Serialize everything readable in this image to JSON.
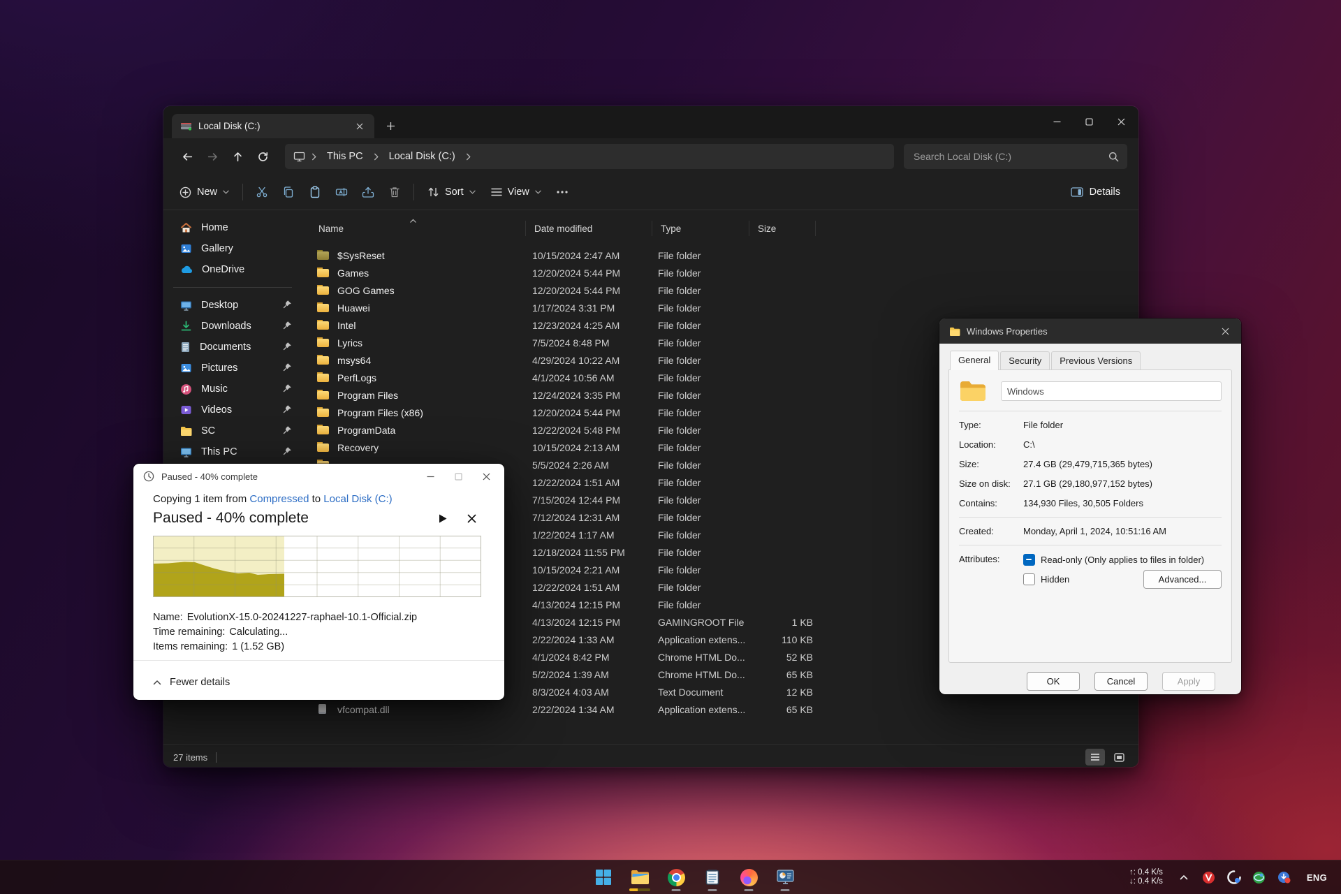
{
  "explorer": {
    "tab_title": "Local Disk (C:)",
    "breadcrumb": {
      "items": [
        "This PC",
        "Local Disk (C:)"
      ]
    },
    "search": {
      "placeholder": "Search Local Disk (C:)"
    },
    "commandbar": {
      "new_label": "New",
      "sort_label": "Sort",
      "view_label": "View",
      "details_label": "Details"
    },
    "columns": {
      "name": "Name",
      "date": "Date modified",
      "type": "Type",
      "size": "Size"
    },
    "sidebar": {
      "items": [
        {
          "label": "Home"
        },
        {
          "label": "Gallery"
        },
        {
          "label": "OneDrive"
        },
        {
          "label": "Desktop"
        },
        {
          "label": "Downloads"
        },
        {
          "label": "Documents"
        },
        {
          "label": "Pictures"
        },
        {
          "label": "Music"
        },
        {
          "label": "Videos"
        },
        {
          "label": "SC"
        },
        {
          "label": "This PC"
        }
      ]
    },
    "files": [
      {
        "name": "$SysReset",
        "date": "10/15/2024 2:47 AM",
        "type": "File folder",
        "size": "",
        "icon": "folder-dim"
      },
      {
        "name": "Games",
        "date": "12/20/2024 5:44 PM",
        "type": "File folder",
        "size": "",
        "icon": "folder"
      },
      {
        "name": "GOG Games",
        "date": "12/20/2024 5:44 PM",
        "type": "File folder",
        "size": "",
        "icon": "folder"
      },
      {
        "name": "Huawei",
        "date": "1/17/2024 3:31 PM",
        "type": "File folder",
        "size": "",
        "icon": "folder"
      },
      {
        "name": "Intel",
        "date": "12/23/2024 4:25 AM",
        "type": "File folder",
        "size": "",
        "icon": "folder"
      },
      {
        "name": "Lyrics",
        "date": "7/5/2024 8:48 PM",
        "type": "File folder",
        "size": "",
        "icon": "folder"
      },
      {
        "name": "msys64",
        "date": "4/29/2024 10:22 AM",
        "type": "File folder",
        "size": "",
        "icon": "folder"
      },
      {
        "name": "PerfLogs",
        "date": "4/1/2024 10:56 AM",
        "type": "File folder",
        "size": "",
        "icon": "folder"
      },
      {
        "name": "Program Files",
        "date": "12/24/2024 3:35 PM",
        "type": "File folder",
        "size": "",
        "icon": "folder"
      },
      {
        "name": "Program Files (x86)",
        "date": "12/20/2024 5:44 PM",
        "type": "File folder",
        "size": "",
        "icon": "folder"
      },
      {
        "name": "ProgramData",
        "date": "12/22/2024 5:48 PM",
        "type": "File folder",
        "size": "",
        "icon": "folder"
      },
      {
        "name": "Recovery",
        "date": "10/15/2024 2:13 AM",
        "type": "File folder",
        "size": "",
        "icon": "folder"
      },
      {
        "name": "",
        "date": "5/5/2024 2:26 AM",
        "type": "File folder",
        "size": "",
        "icon": "folder"
      },
      {
        "name": "",
        "date": "12/22/2024 1:51 AM",
        "type": "File folder",
        "size": "",
        "icon": "folder"
      },
      {
        "name": "",
        "date": "7/15/2024 12:44 PM",
        "type": "File folder",
        "size": "",
        "icon": "folder"
      },
      {
        "name": "",
        "date": "7/12/2024 12:31 AM",
        "type": "File folder",
        "size": "",
        "icon": "folder"
      },
      {
        "name": "",
        "date": "1/22/2024 1:17 AM",
        "type": "File folder",
        "size": "",
        "icon": "folder"
      },
      {
        "name": "",
        "date": "12/18/2024 11:55 PM",
        "type": "File folder",
        "size": "",
        "icon": "folder"
      },
      {
        "name": "",
        "date": "10/15/2024 2:21 AM",
        "type": "File folder",
        "size": "",
        "icon": "folder"
      },
      {
        "name": "",
        "date": "12/22/2024 1:51 AM",
        "type": "File folder",
        "size": "",
        "icon": "folder"
      },
      {
        "name": "",
        "date": "4/13/2024 12:15 PM",
        "type": "File folder",
        "size": "",
        "icon": "folder"
      },
      {
        "name": "",
        "date": "4/13/2024 12:15 PM",
        "type": "GAMINGROOT File",
        "size": "1 KB",
        "icon": "none"
      },
      {
        "name": "",
        "date": "2/22/2024 1:33 AM",
        "type": "Application extens...",
        "size": "110 KB",
        "icon": "none"
      },
      {
        "name": "",
        "date": "4/1/2024 8:42 PM",
        "type": "Chrome HTML Do...",
        "size": "52 KB",
        "icon": "none"
      },
      {
        "name": "",
        "date": "5/2/2024 1:39 AM",
        "type": "Chrome HTML Do...",
        "size": "65 KB",
        "icon": "none"
      },
      {
        "name": "",
        "date": "8/3/2024 4:03 AM",
        "type": "Text Document",
        "size": "12 KB",
        "icon": "none"
      },
      {
        "name": "vfcompat.dll",
        "date": "2/22/2024 1:34 AM",
        "type": "Application extens...",
        "size": "65 KB",
        "icon": "dll"
      }
    ],
    "status": {
      "items_count": "27 items"
    }
  },
  "copy_dialog": {
    "title": "Paused - 40% complete",
    "copy_line": {
      "prefix": "Copying 1 item from",
      "source": "Compressed",
      "connector": "to",
      "dest": "Local Disk (C:)"
    },
    "status_heading": "Paused - 40% complete",
    "fields": [
      {
        "label": "Name:",
        "value": "EvolutionX-15.0-20241227-raphael-10.1-Official.zip"
      },
      {
        "label": "Time remaining:",
        "value": "Calculating..."
      },
      {
        "label": "Items remaining:",
        "value": "1 (1.52 GB)"
      }
    ],
    "fewer_details": "Fewer details",
    "progress_percent": 40
  },
  "properties_dialog": {
    "title": "Windows Properties",
    "tabs": [
      "General",
      "Security",
      "Previous Versions"
    ],
    "name_value": "Windows",
    "info_rows": [
      {
        "label": "Type:",
        "value": "File folder"
      },
      {
        "label": "Location:",
        "value": "C:\\"
      },
      {
        "label": "Size:",
        "value": "27.4 GB (29,479,715,365 bytes)"
      },
      {
        "label": "Size on disk:",
        "value": "27.1 GB (29,180,977,152 bytes)"
      },
      {
        "label": "Contains:",
        "value": "134,930 Files, 30,505 Folders"
      }
    ],
    "created": {
      "label": "Created:",
      "value": "Monday, April 1, 2024, 10:51:16 AM"
    },
    "attributes": {
      "label": "Attributes:",
      "readonly_label": "Read-only (Only applies to files in folder)",
      "hidden_label": "Hidden",
      "advanced_label": "Advanced..."
    },
    "buttons": {
      "ok": "OK",
      "cancel": "Cancel",
      "apply": "Apply"
    }
  },
  "taskbar": {
    "apps": [
      "start",
      "file-explorer",
      "chrome",
      "notepad",
      "firefox",
      "system-monitor"
    ],
    "tray": [
      "tray-chevron",
      "antivirus-tray",
      "ai-assistant-tray",
      "network-app-tray",
      "downloader-tray"
    ],
    "net_up": "↑: 0.4 K/s",
    "net_down": "↓: 0.4 K/s",
    "language": "ENG"
  }
}
